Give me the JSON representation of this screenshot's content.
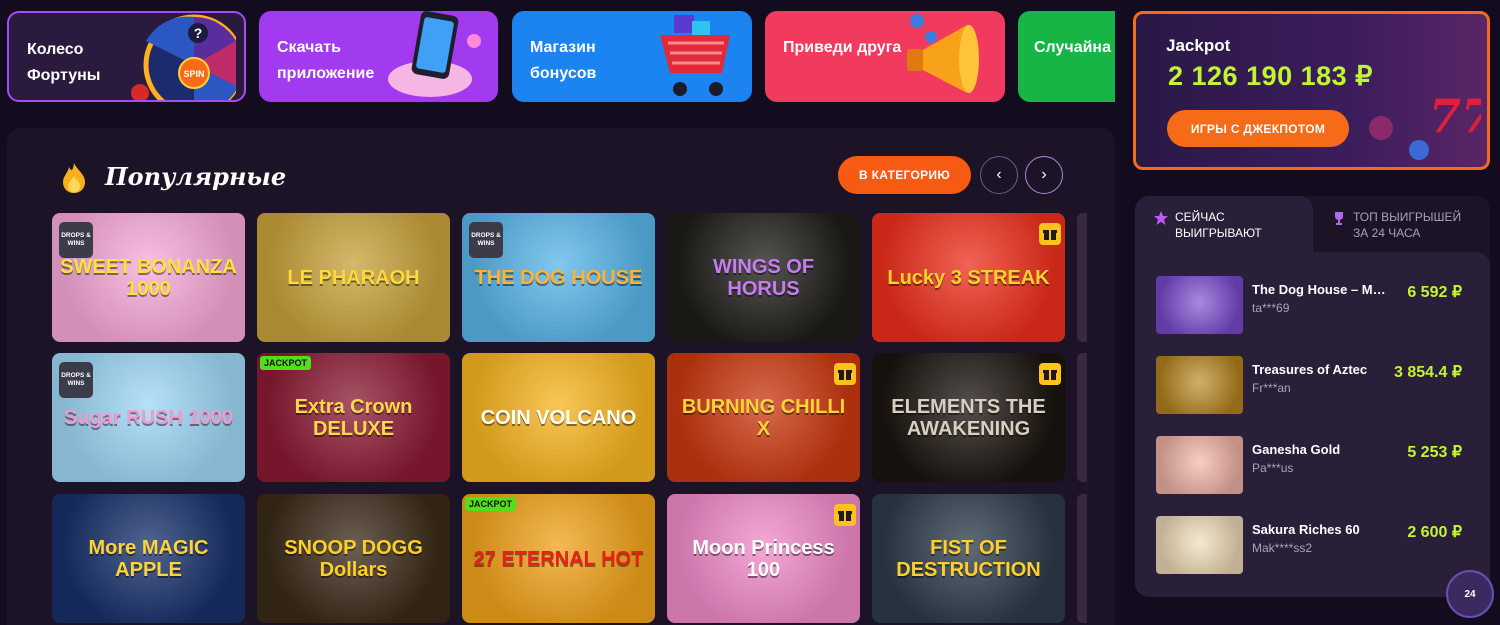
{
  "promos": [
    {
      "label": "Колесо Фортуны",
      "icon": "fortune-wheel-icon",
      "art_text": "SPIN"
    },
    {
      "label": "Скачать приложение",
      "icon": "phone-app-icon"
    },
    {
      "label": "Магазин бонусов",
      "icon": "shopping-cart-icon"
    },
    {
      "label": "Приведи друга",
      "icon": "megaphone-icon"
    },
    {
      "label": "Случайна игра",
      "icon": "dice-icon"
    }
  ],
  "games_section": {
    "title": "Популярные",
    "category_button": "В КАТЕГОРИЮ",
    "prev_label": "‹",
    "next_label": "›"
  },
  "games": [
    {
      "name": "SWEET BONANZA 1000",
      "tag": "DROPS & WINS",
      "bg": "#f7a9d8",
      "fg": "#ffe23a"
    },
    {
      "name": "LE PHARAOH",
      "tag": "",
      "bg": "#c7a13a",
      "fg": "#ffd93a"
    },
    {
      "name": "THE DOG HOUSE",
      "tag": "DROPS & WINS",
      "bg": "#58b5e8",
      "fg": "#ffb23a"
    },
    {
      "name": "WINGS OF HORUS",
      "tag": "",
      "bg": "#1e1c18",
      "fg": "#c67cf0"
    },
    {
      "name": "Lucky 3 STREAK",
      "tag": "gift",
      "bg": "#ec2f1c",
      "fg": "#ffd12a"
    },
    {
      "name": "Sugar RUSH 1000",
      "tag": "DROPS & WINS",
      "bg": "#9dd6f5",
      "fg": "#f29ad0"
    },
    {
      "name": "Extra Crown DELUXE",
      "tag": "JACKPOT",
      "bg": "#8a1a34",
      "fg": "#ffd84a"
    },
    {
      "name": "COIN VOLCANO",
      "tag": "",
      "bg": "#f7b41e",
      "fg": "#ffffff"
    },
    {
      "name": "BURNING CHILLI X",
      "tag": "gift",
      "bg": "#c9380f",
      "fg": "#ffd23a"
    },
    {
      "name": "ELEMENTS THE AWAKENING",
      "tag": "gift",
      "bg": "#1b1410",
      "fg": "#d8cfc0"
    },
    {
      "name": "More MAGIC APPLE",
      "tag": "",
      "bg": "#17306a",
      "fg": "#ffd33a"
    },
    {
      "name": "SNOOP DOGG Dollars",
      "tag": "",
      "bg": "#3a2a18",
      "fg": "#ffcf26"
    },
    {
      "name": "27 ETERNAL HOT",
      "tag": "JACKPOT",
      "bg": "#f0a21a",
      "fg": "#e82018"
    },
    {
      "name": "Moon Princess 100",
      "tag": "gift",
      "bg": "#f08ac8",
      "fg": "#ffffff"
    },
    {
      "name": "FIST OF DESTRUCTION",
      "tag": "",
      "bg": "#2c3a4a",
      "fg": "#ffcf2a"
    }
  ],
  "jackpot": {
    "label": "Jackpot",
    "amount": "2 126 190 183 ₽",
    "button": "ИГРЫ С ДЖЕКПОТОМ"
  },
  "winners": {
    "tab_now": "СЕЙЧАС ВЫИГРЫВАЮТ",
    "tab_top": "ТОП ВЫИГРЫШЕЙ ЗА 24 ЧАСА",
    "rows": [
      {
        "game": "The Dog House – Muttley Crew",
        "user": "ta***69",
        "amount": "6 592 ₽",
        "bg": "#7a4ad0"
      },
      {
        "game": "Treasures of Aztec",
        "user": "Fr***an",
        "amount": "3 854.4 ₽",
        "bg": "#b8861e"
      },
      {
        "game": "Ganesha Gold",
        "user": "Pa***us",
        "amount": "5 253 ₽",
        "bg": "#f3b4a6"
      },
      {
        "game": "Sakura Riches 60",
        "user": "Mak****ss2",
        "amount": "2 600 ₽",
        "bg": "#f1dcb8"
      }
    ]
  },
  "support": {
    "label": "24"
  }
}
